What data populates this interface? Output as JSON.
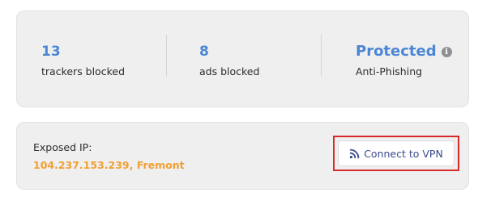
{
  "stats": {
    "trackers": {
      "value": "13",
      "label": "trackers blocked"
    },
    "ads": {
      "value": "8",
      "label": "ads blocked"
    },
    "protection": {
      "value": "Protected",
      "label": "Anti-Phishing",
      "info_icon": "info-icon"
    }
  },
  "ip_panel": {
    "label": "Exposed IP:",
    "value": "104.237.153.239, Fremont",
    "vpn_button": {
      "label": "Connect to VPN",
      "icon": "rss-signal-icon"
    }
  },
  "colors": {
    "accent_blue": "#4a86d4",
    "ip_orange": "#f0a030",
    "highlight_red": "#d82a2a",
    "button_text": "#3a4a8c"
  }
}
